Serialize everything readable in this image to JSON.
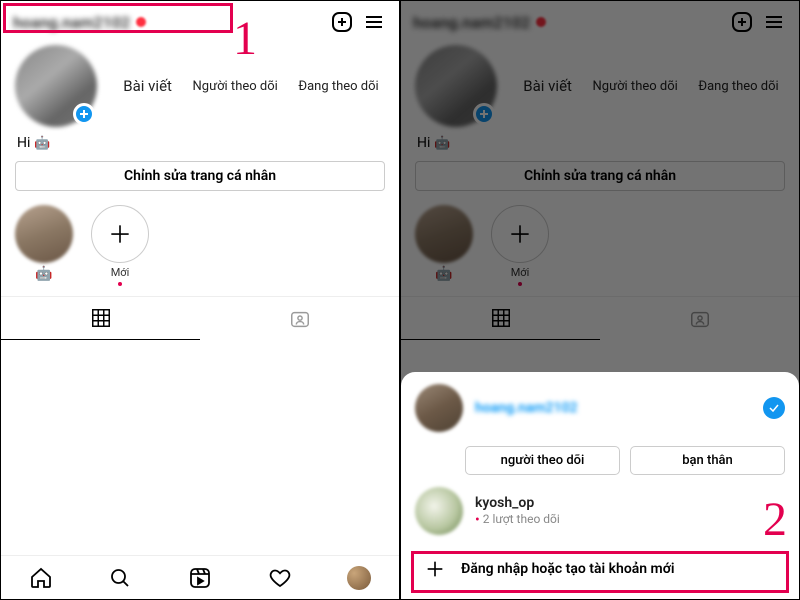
{
  "header": {
    "username": "hoang.nam2102"
  },
  "stats": {
    "posts_label": "Bài viết",
    "followers_label": "Người theo dõi",
    "following_label": "Đang theo dõi"
  },
  "bio": {
    "text": "Hi"
  },
  "edit_profile_label": "Chỉnh sửa trang cá nhân",
  "highlights": {
    "first_label": "",
    "new_label": "Mới"
  },
  "steps": {
    "one": "1",
    "two": "2"
  },
  "sheet": {
    "account1_name": "hoang.nam2102",
    "pill_followers": "người theo dõi",
    "pill_close_friends": "bạn thân",
    "account2_name": "kyosh_op",
    "account2_sub": "2 lượt theo dõi",
    "add_account_label": "Đăng nhập hoặc tạo tài khoản mới"
  }
}
